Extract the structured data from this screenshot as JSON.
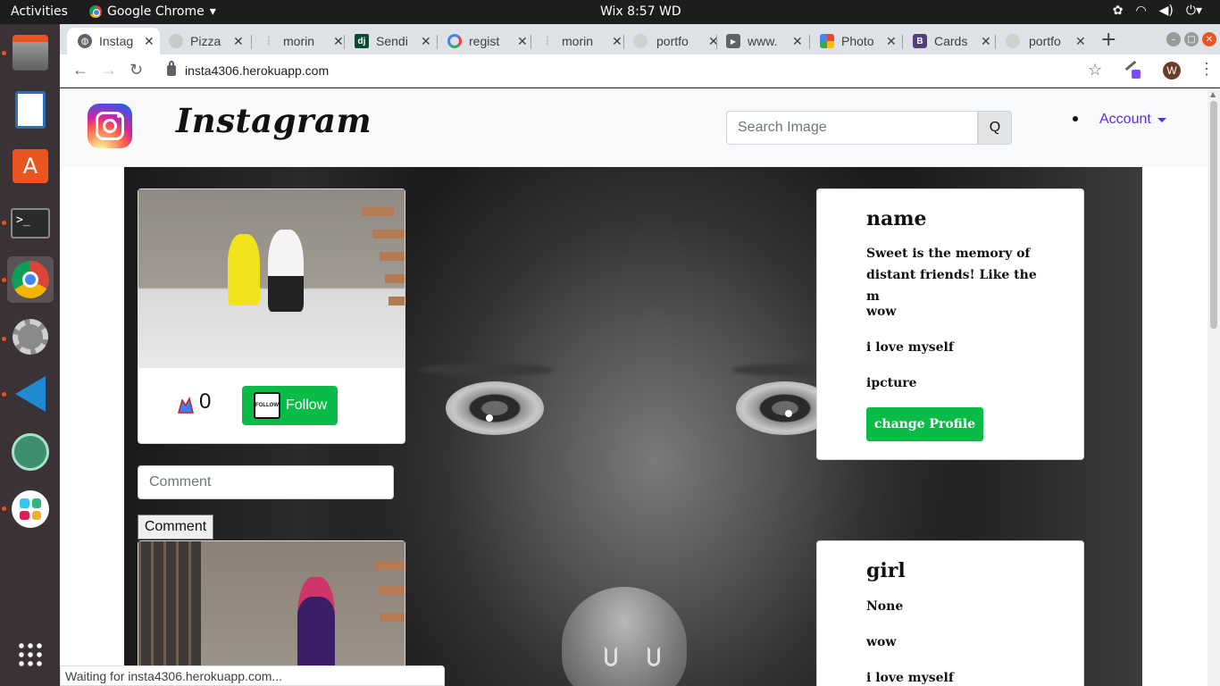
{
  "system": {
    "activities": "Activities",
    "app_name": "Google Chrome",
    "clock": "Wix  8:57 WD",
    "tray_icons": [
      "network-icon",
      "wifi-icon",
      "volume-icon",
      "power-icon"
    ]
  },
  "browser": {
    "tabs": [
      {
        "title": "Instag",
        "icon": "globe-icon",
        "active": true
      },
      {
        "title": "Pizza",
        "icon": "page-icon",
        "active": false
      },
      {
        "title": "morin",
        "icon": "page-icon",
        "active": false
      },
      {
        "title": "Sendi",
        "icon": "django-icon",
        "active": false
      },
      {
        "title": "regist",
        "icon": "google-icon",
        "active": false
      },
      {
        "title": "morin",
        "icon": "page-icon",
        "active": false
      },
      {
        "title": "portfo",
        "icon": "page-icon",
        "active": false
      },
      {
        "title": "www.",
        "icon": "youtube-icon",
        "active": false
      },
      {
        "title": "Photo",
        "icon": "photos-icon",
        "active": false
      },
      {
        "title": "Cards",
        "icon": "bootstrap-icon",
        "active": false
      },
      {
        "title": "portfo",
        "icon": "page-icon",
        "active": false
      }
    ],
    "url": "insta4306.herokuapp.com",
    "profile_initial": "W",
    "status_text": "Waiting for insta4306.herokuapp.com..."
  },
  "site": {
    "brand": "Instagram",
    "search_placeholder": "Search Image",
    "search_button": "Q",
    "account_label": "Account",
    "accent_color": "#0abb48",
    "link_color": "#5a2ddf"
  },
  "posts": [
    {
      "likes": "0",
      "follow_label": "Follow",
      "follow_badge": "FOLLOW",
      "comment_placeholder": "Comment",
      "comment_button": "Comment"
    }
  ],
  "profiles": [
    {
      "name": "name",
      "bio": "Sweet is the memory of distant friends! Like the m",
      "lines": [
        "wow",
        "i love myself",
        "ipcture"
      ],
      "button": "change Profile"
    },
    {
      "name": "girl",
      "bio": "None",
      "lines": [
        "wow",
        "i love myself"
      ]
    }
  ]
}
